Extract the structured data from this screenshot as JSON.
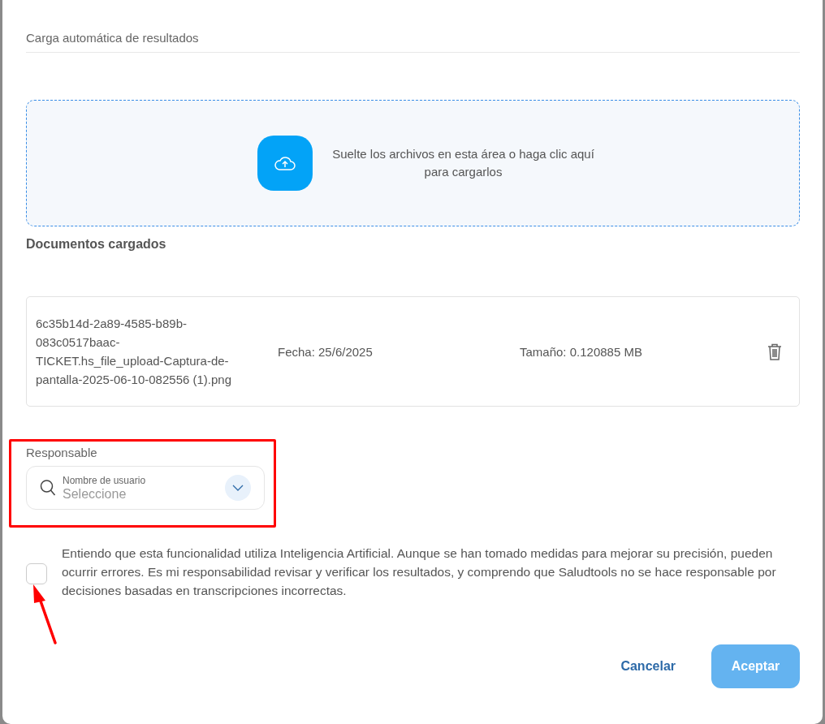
{
  "modal": {
    "title": "Carga automática de resultados"
  },
  "dropzone": {
    "text": "Suelte los archivos en esta área o haga clic aquí para cargarlos"
  },
  "documents": {
    "heading": "Documentos cargados",
    "files": [
      {
        "name": "6c35b14d-2a89-4585-b89b-083c0517baac-TICKET.hs_file_upload-Captura-de-pantalla-2025-06-10-082556 (1).png",
        "date": "Fecha: 25/6/2025",
        "size": "Tamaño: 0.120885 MB"
      }
    ]
  },
  "responsible": {
    "label": "Responsable",
    "field_label": "Nombre de usuario",
    "placeholder": "Seleccione"
  },
  "consent": {
    "checked": false,
    "text": "Entiendo que esta funcionalidad utiliza Inteligencia Artificial. Aunque se han tomado medidas para mejorar su precisión, pueden ocurrir errores. Es mi responsabilidad revisar y verificar los resultados, y comprendo que Saludtools no se hace responsable por decisiones basadas en transcripciones incorrectas."
  },
  "buttons": [
    {
      "label": "Cancelar",
      "kind": "text",
      "disabled": false
    },
    {
      "label": "Aceptar",
      "kind": "primary",
      "disabled": true
    }
  ]
}
